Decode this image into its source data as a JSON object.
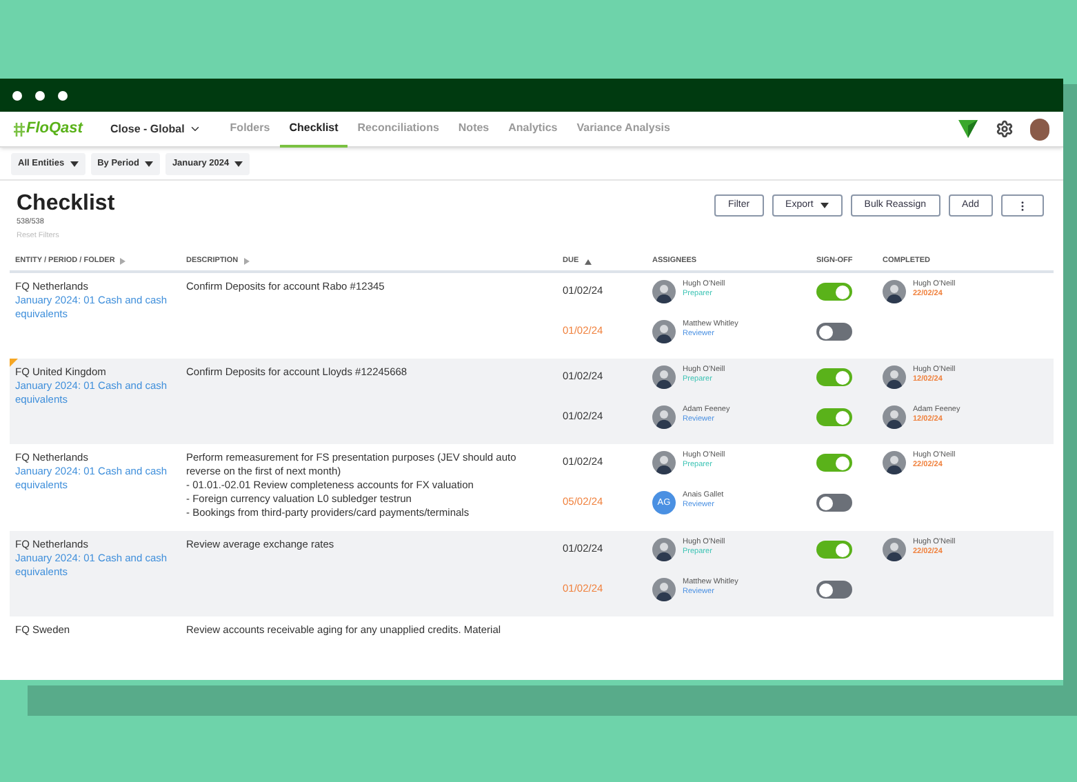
{
  "app": {
    "logo": "FloQast",
    "workspace": "Close - Global"
  },
  "tabs": [
    {
      "label": "Folders",
      "selected": false
    },
    {
      "label": "Checklist",
      "selected": true
    },
    {
      "label": "Reconciliations",
      "selected": false
    },
    {
      "label": "Notes",
      "selected": false
    },
    {
      "label": "Analytics",
      "selected": false
    },
    {
      "label": "Variance Analysis",
      "selected": false
    }
  ],
  "filters": [
    {
      "label": "All Entities"
    },
    {
      "label": "By Period"
    },
    {
      "label": "January 2024"
    }
  ],
  "page": {
    "title": "Checklist",
    "count": "538/538",
    "reset": "Reset Filters"
  },
  "actions": [
    {
      "label": "Filter",
      "kind": "plain"
    },
    {
      "label": "Export",
      "kind": "dropdown"
    },
    {
      "label": "Bulk Reassign",
      "kind": "plain"
    },
    {
      "label": "Add",
      "kind": "plain"
    },
    {
      "kind": "more"
    }
  ],
  "columns": [
    {
      "label": "ENTITY / PERIOD / FOLDER",
      "kind": "sortable"
    },
    {
      "label": "DESCRIPTION",
      "kind": "sortable"
    },
    {
      "label": "DUE",
      "kind": "ascending"
    },
    {
      "label": "ASSIGNEES",
      "kind": "plain"
    },
    {
      "label": "SIGN-OFF",
      "kind": "plain"
    },
    {
      "label": "COMPLETED",
      "kind": "plain"
    }
  ],
  "rows": [
    {
      "entity": "FQ Netherlands",
      "folder": "January 2024: 01 Cash and cash equivalents",
      "flagged": false,
      "description": [
        "Confirm Deposits for account Rabo #12345"
      ],
      "assignees": [
        {
          "due": "01/02/24",
          "overdue": false,
          "name": "Hugh O'Neill",
          "role": "Preparer",
          "kind": "preparer",
          "signed_off": true,
          "completed": {
            "name": "Hugh O'Neill",
            "date": "22/02/24"
          }
        },
        {
          "due": "01/02/24",
          "overdue": true,
          "name": "Matthew Whitley",
          "role": "Reviewer",
          "kind": "reviewer",
          "signed_off": false
        }
      ]
    },
    {
      "entity": "FQ United Kingdom",
      "folder": "January 2024: 01 Cash and cash equivalents",
      "flagged": true,
      "description": [
        "Confirm Deposits for account Lloyds #12245668"
      ],
      "assignees": [
        {
          "due": "01/02/24",
          "overdue": false,
          "name": "Hugh O'Neill",
          "role": "Preparer",
          "kind": "preparer",
          "signed_off": true,
          "completed": {
            "name": "Hugh O'Neill",
            "date": "12/02/24"
          }
        },
        {
          "due": "01/02/24",
          "overdue": false,
          "name": "Adam Feeney",
          "role": "Reviewer",
          "kind": "reviewer",
          "signed_off": true,
          "completed": {
            "name": "Adam Feeney",
            "date": "12/02/24"
          }
        }
      ]
    },
    {
      "entity": "FQ Netherlands",
      "folder": "January 2024: 01 Cash and cash equivalents",
      "flagged": false,
      "description": [
        "Perform remeasurement for FS presentation purposes (JEV should auto reverse on the first of next month)",
        "- 01.01.-02.01 Review completeness accounts for FX valuation",
        "- Foreign currency valuation L0 subledger testrun",
        "- Bookings from third-party providers/card payments/terminals"
      ],
      "assignees": [
        {
          "due": "01/02/24",
          "overdue": false,
          "name": "Hugh O'Neill",
          "role": "Preparer",
          "kind": "preparer",
          "signed_off": true,
          "completed": {
            "name": "Hugh O'Neill",
            "date": "22/02/24"
          }
        },
        {
          "due": "05/02/24",
          "overdue": true,
          "name": "Anais Gallet",
          "initials": "AG",
          "role": "Reviewer",
          "kind": "reviewer",
          "signed_off": false
        }
      ]
    },
    {
      "entity": "FQ Netherlands",
      "folder": "January 2024: 01 Cash and cash equivalents",
      "flagged": false,
      "description": [
        "Review average exchange rates"
      ],
      "assignees": [
        {
          "due": "01/02/24",
          "overdue": false,
          "name": "Hugh O'Neill",
          "role": "Preparer",
          "kind": "preparer",
          "signed_off": true,
          "completed": {
            "name": "Hugh O'Neill",
            "date": "22/02/24"
          }
        },
        {
          "due": "01/02/24",
          "overdue": true,
          "name": "Matthew Whitley",
          "role": "Reviewer",
          "kind": "reviewer",
          "signed_off": false
        }
      ]
    },
    {
      "entity": "FQ Sweden",
      "flagged": false,
      "description": [
        "Review accounts receivable aging for any unapplied credits. Material"
      ],
      "assignees": []
    }
  ]
}
